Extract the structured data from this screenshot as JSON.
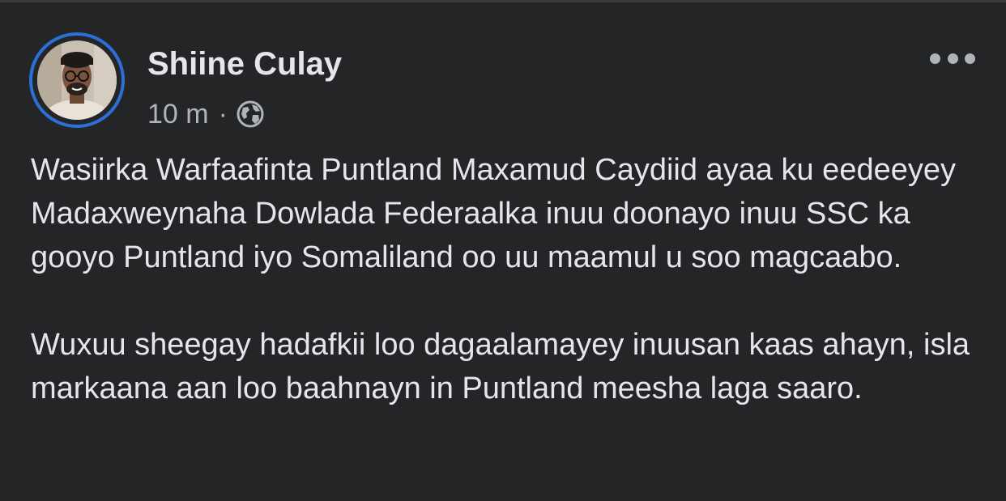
{
  "post": {
    "author": "Shiine Culay",
    "time": "10 m",
    "separator": "·",
    "audience_icon": "globe-icon",
    "more_icon": "more-options-icon",
    "paragraphs": [
      "Wasiirka Warfaafinta Puntland Maxamud Caydiid ayaa ku eedeeyey Madaxweynaha Dowlada Federaalka inuu doonayo inuu SSC ka gooyo Puntland iyo Somaliland oo uu maamul u soo magcaabo.",
      "Wuxuu sheegay hadafkii loo dagaalamayey inuusan kaas ahayn, isla markaana aan loo baahnayn in Puntland meesha laga saaro."
    ]
  },
  "colors": {
    "background": "#242526",
    "primary_text": "#e4e6eb",
    "secondary_text": "#b0b3b8",
    "story_ring": "#2d6fd6"
  }
}
